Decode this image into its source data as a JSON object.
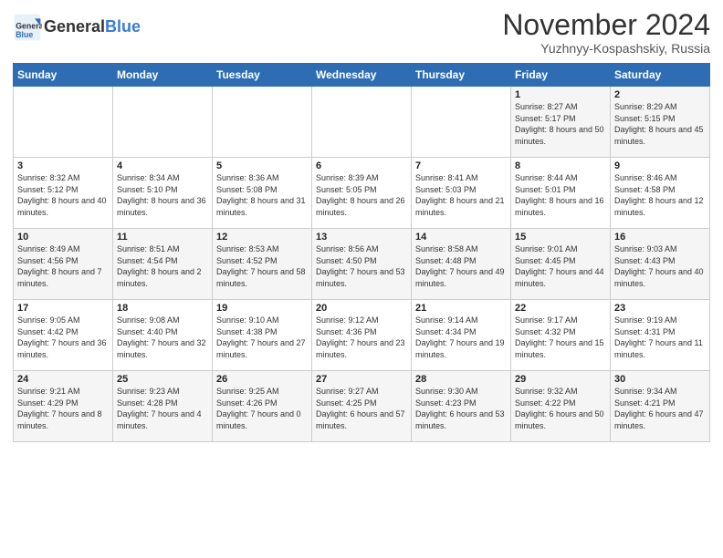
{
  "header": {
    "logo_line1": "General",
    "logo_line2": "Blue",
    "month": "November 2024",
    "location": "Yuzhnyy-Kospashskiy, Russia"
  },
  "days_of_week": [
    "Sunday",
    "Monday",
    "Tuesday",
    "Wednesday",
    "Thursday",
    "Friday",
    "Saturday"
  ],
  "weeks": [
    [
      {
        "day": "",
        "info": ""
      },
      {
        "day": "",
        "info": ""
      },
      {
        "day": "",
        "info": ""
      },
      {
        "day": "",
        "info": ""
      },
      {
        "day": "",
        "info": ""
      },
      {
        "day": "1",
        "info": "Sunrise: 8:27 AM\nSunset: 5:17 PM\nDaylight: 8 hours and 50 minutes."
      },
      {
        "day": "2",
        "info": "Sunrise: 8:29 AM\nSunset: 5:15 PM\nDaylight: 8 hours and 45 minutes."
      }
    ],
    [
      {
        "day": "3",
        "info": "Sunrise: 8:32 AM\nSunset: 5:12 PM\nDaylight: 8 hours and 40 minutes."
      },
      {
        "day": "4",
        "info": "Sunrise: 8:34 AM\nSunset: 5:10 PM\nDaylight: 8 hours and 36 minutes."
      },
      {
        "day": "5",
        "info": "Sunrise: 8:36 AM\nSunset: 5:08 PM\nDaylight: 8 hours and 31 minutes."
      },
      {
        "day": "6",
        "info": "Sunrise: 8:39 AM\nSunset: 5:05 PM\nDaylight: 8 hours and 26 minutes."
      },
      {
        "day": "7",
        "info": "Sunrise: 8:41 AM\nSunset: 5:03 PM\nDaylight: 8 hours and 21 minutes."
      },
      {
        "day": "8",
        "info": "Sunrise: 8:44 AM\nSunset: 5:01 PM\nDaylight: 8 hours and 16 minutes."
      },
      {
        "day": "9",
        "info": "Sunrise: 8:46 AM\nSunset: 4:58 PM\nDaylight: 8 hours and 12 minutes."
      }
    ],
    [
      {
        "day": "10",
        "info": "Sunrise: 8:49 AM\nSunset: 4:56 PM\nDaylight: 8 hours and 7 minutes."
      },
      {
        "day": "11",
        "info": "Sunrise: 8:51 AM\nSunset: 4:54 PM\nDaylight: 8 hours and 2 minutes."
      },
      {
        "day": "12",
        "info": "Sunrise: 8:53 AM\nSunset: 4:52 PM\nDaylight: 7 hours and 58 minutes."
      },
      {
        "day": "13",
        "info": "Sunrise: 8:56 AM\nSunset: 4:50 PM\nDaylight: 7 hours and 53 minutes."
      },
      {
        "day": "14",
        "info": "Sunrise: 8:58 AM\nSunset: 4:48 PM\nDaylight: 7 hours and 49 minutes."
      },
      {
        "day": "15",
        "info": "Sunrise: 9:01 AM\nSunset: 4:45 PM\nDaylight: 7 hours and 44 minutes."
      },
      {
        "day": "16",
        "info": "Sunrise: 9:03 AM\nSunset: 4:43 PM\nDaylight: 7 hours and 40 minutes."
      }
    ],
    [
      {
        "day": "17",
        "info": "Sunrise: 9:05 AM\nSunset: 4:42 PM\nDaylight: 7 hours and 36 minutes."
      },
      {
        "day": "18",
        "info": "Sunrise: 9:08 AM\nSunset: 4:40 PM\nDaylight: 7 hours and 32 minutes."
      },
      {
        "day": "19",
        "info": "Sunrise: 9:10 AM\nSunset: 4:38 PM\nDaylight: 7 hours and 27 minutes."
      },
      {
        "day": "20",
        "info": "Sunrise: 9:12 AM\nSunset: 4:36 PM\nDaylight: 7 hours and 23 minutes."
      },
      {
        "day": "21",
        "info": "Sunrise: 9:14 AM\nSunset: 4:34 PM\nDaylight: 7 hours and 19 minutes."
      },
      {
        "day": "22",
        "info": "Sunrise: 9:17 AM\nSunset: 4:32 PM\nDaylight: 7 hours and 15 minutes."
      },
      {
        "day": "23",
        "info": "Sunrise: 9:19 AM\nSunset: 4:31 PM\nDaylight: 7 hours and 11 minutes."
      }
    ],
    [
      {
        "day": "24",
        "info": "Sunrise: 9:21 AM\nSunset: 4:29 PM\nDaylight: 7 hours and 8 minutes."
      },
      {
        "day": "25",
        "info": "Sunrise: 9:23 AM\nSunset: 4:28 PM\nDaylight: 7 hours and 4 minutes."
      },
      {
        "day": "26",
        "info": "Sunrise: 9:25 AM\nSunset: 4:26 PM\nDaylight: 7 hours and 0 minutes."
      },
      {
        "day": "27",
        "info": "Sunrise: 9:27 AM\nSunset: 4:25 PM\nDaylight: 6 hours and 57 minutes."
      },
      {
        "day": "28",
        "info": "Sunrise: 9:30 AM\nSunset: 4:23 PM\nDaylight: 6 hours and 53 minutes."
      },
      {
        "day": "29",
        "info": "Sunrise: 9:32 AM\nSunset: 4:22 PM\nDaylight: 6 hours and 50 minutes."
      },
      {
        "day": "30",
        "info": "Sunrise: 9:34 AM\nSunset: 4:21 PM\nDaylight: 6 hours and 47 minutes."
      }
    ]
  ]
}
